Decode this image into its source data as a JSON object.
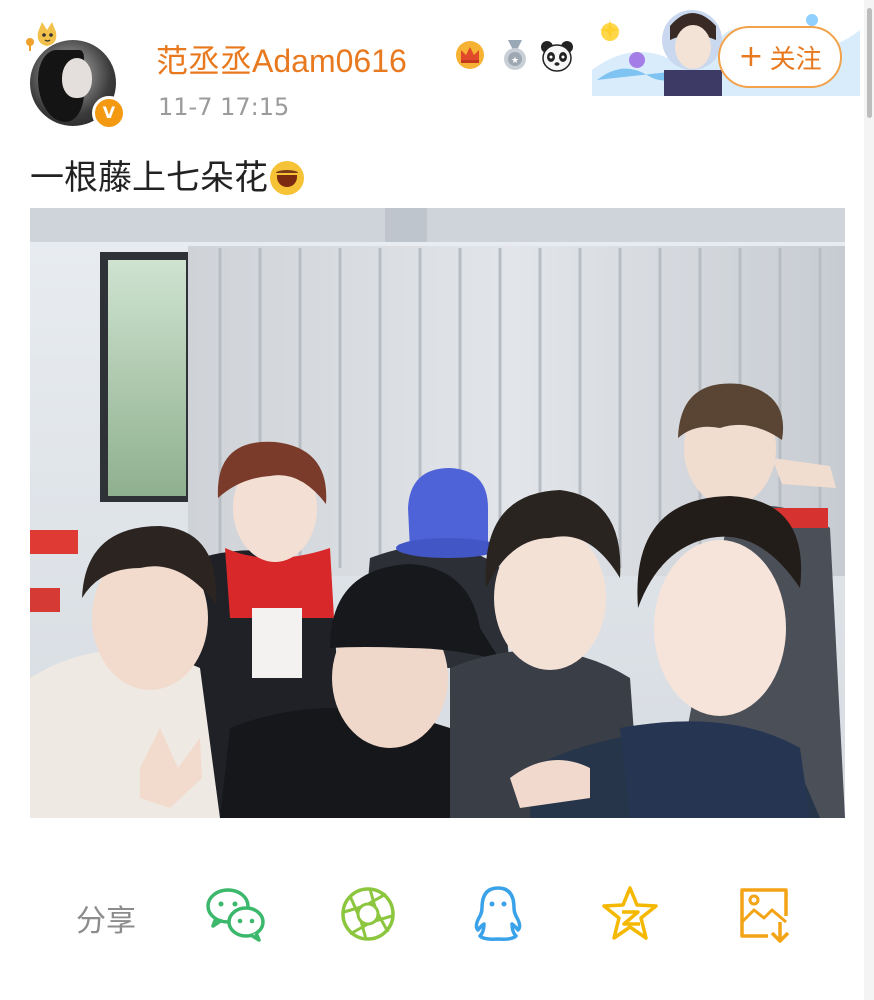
{
  "post": {
    "username": "范丞丞Adam0616",
    "timestamp": "11-7 17:15",
    "text": "一根藤上七朵花",
    "follow_label": "关注",
    "follow_plus": "+"
  },
  "share": {
    "label": "分享"
  },
  "icons": {
    "verified": "verified-v-icon",
    "crown": "crown-icon",
    "medal": "medal-icon",
    "panda": "panda-icon",
    "share_targets": [
      "wechat-icon",
      "moments-icon",
      "qq-icon",
      "qzone-icon",
      "save-image-icon"
    ]
  },
  "colors": {
    "accent": "#e8791f",
    "follow_border": "#f2a24a",
    "wechat": "#3bb86b",
    "moments": "#8cc63f",
    "qq": "#3aa2e8",
    "qzone": "#f5b800",
    "save": "#f3a316"
  }
}
